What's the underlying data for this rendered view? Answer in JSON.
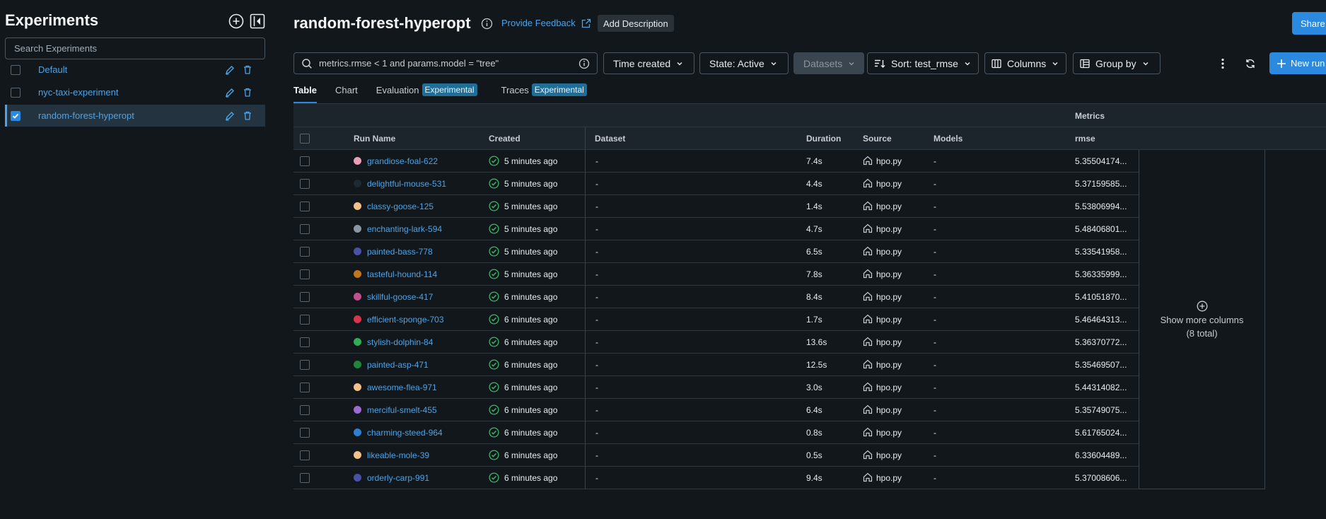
{
  "sidebar": {
    "title": "Experiments",
    "search_placeholder": "Search Experiments",
    "experiments": [
      {
        "name": "Default",
        "checked": false
      },
      {
        "name": "nyc-taxi-experiment",
        "checked": false
      },
      {
        "name": "random-forest-hyperopt",
        "checked": true
      }
    ]
  },
  "header": {
    "title": "random-forest-hyperopt",
    "feedback_label": "Provide Feedback",
    "add_description_label": "Add Description",
    "share_label": "Share"
  },
  "toolbar": {
    "filter_value": "metrics.rmse < 1 and params.model = \"tree\"",
    "time_created_label": "Time created",
    "state_label": "State: Active",
    "datasets_label": "Datasets",
    "sort_label": "Sort: test_rmse",
    "columns_label": "Columns",
    "group_by_label": "Group by",
    "new_run_label": "New run"
  },
  "tabs": [
    {
      "label": "Table",
      "badge": ""
    },
    {
      "label": "Chart",
      "badge": ""
    },
    {
      "label": "Evaluation",
      "badge": "Experimental"
    },
    {
      "label": "Traces",
      "badge": "Experimental"
    }
  ],
  "table": {
    "group_label": "Metrics",
    "columns": [
      "Run Name",
      "Created",
      "Dataset",
      "Duration",
      "Source",
      "Models",
      "rmse"
    ],
    "more_columns_line1": "Show more columns",
    "more_columns_line2": "(8 total)",
    "rows": [
      {
        "name": "grandiose-foal-622",
        "color": "#e8a0b4",
        "created": "5 minutes ago",
        "dataset": "-",
        "duration": "7.4s",
        "source": "hpo.py",
        "models": "-",
        "rmse": "5.35504174..."
      },
      {
        "name": "delightful-mouse-531",
        "color": "#1e2a33",
        "created": "5 minutes ago",
        "dataset": "-",
        "duration": "4.4s",
        "source": "hpo.py",
        "models": "-",
        "rmse": "5.37159585..."
      },
      {
        "name": "classy-goose-125",
        "color": "#f2c08a",
        "created": "5 minutes ago",
        "dataset": "-",
        "duration": "1.4s",
        "source": "hpo.py",
        "models": "-",
        "rmse": "5.53806994..."
      },
      {
        "name": "enchanting-lark-594",
        "color": "#8a96a3",
        "created": "5 minutes ago",
        "dataset": "-",
        "duration": "4.7s",
        "source": "hpo.py",
        "models": "-",
        "rmse": "5.48406801..."
      },
      {
        "name": "painted-bass-778",
        "color": "#4a52a8",
        "created": "5 minutes ago",
        "dataset": "-",
        "duration": "6.5s",
        "source": "hpo.py",
        "models": "-",
        "rmse": "5.33541958..."
      },
      {
        "name": "tasteful-hound-114",
        "color": "#c0781a",
        "created": "5 minutes ago",
        "dataset": "-",
        "duration": "7.8s",
        "source": "hpo.py",
        "models": "-",
        "rmse": "5.36335999..."
      },
      {
        "name": "skillful-goose-417",
        "color": "#c0508f",
        "created": "6 minutes ago",
        "dataset": "-",
        "duration": "8.4s",
        "source": "hpo.py",
        "models": "-",
        "rmse": "5.41051870..."
      },
      {
        "name": "efficient-sponge-703",
        "color": "#d6354a",
        "created": "6 minutes ago",
        "dataset": "-",
        "duration": "1.7s",
        "source": "hpo.py",
        "models": "-",
        "rmse": "5.46464313..."
      },
      {
        "name": "stylish-dolphin-84",
        "color": "#2fae55",
        "created": "6 minutes ago",
        "dataset": "-",
        "duration": "13.6s",
        "source": "hpo.py",
        "models": "-",
        "rmse": "5.36370772..."
      },
      {
        "name": "painted-asp-471",
        "color": "#22863a",
        "created": "6 minutes ago",
        "dataset": "-",
        "duration": "12.5s",
        "source": "hpo.py",
        "models": "-",
        "rmse": "5.35469507..."
      },
      {
        "name": "awesome-flea-971",
        "color": "#f2c08a",
        "created": "6 minutes ago",
        "dataset": "-",
        "duration": "3.0s",
        "source": "hpo.py",
        "models": "-",
        "rmse": "5.44314082..."
      },
      {
        "name": "merciful-smelt-455",
        "color": "#9b6bd1",
        "created": "6 minutes ago",
        "dataset": "-",
        "duration": "6.4s",
        "source": "hpo.py",
        "models": "-",
        "rmse": "5.35749075..."
      },
      {
        "name": "charming-steed-964",
        "color": "#2f7fd0",
        "created": "6 minutes ago",
        "dataset": "-",
        "duration": "0.8s",
        "source": "hpo.py",
        "models": "-",
        "rmse": "5.61765024..."
      },
      {
        "name": "likeable-mole-39",
        "color": "#f2c08a",
        "created": "6 minutes ago",
        "dataset": "-",
        "duration": "0.5s",
        "source": "hpo.py",
        "models": "-",
        "rmse": "6.33604489..."
      },
      {
        "name": "orderly-carp-991",
        "color": "#4a52a8",
        "created": "6 minutes ago",
        "dataset": "-",
        "duration": "9.4s",
        "source": "hpo.py",
        "models": "-",
        "rmse": "5.37008606..."
      }
    ]
  }
}
